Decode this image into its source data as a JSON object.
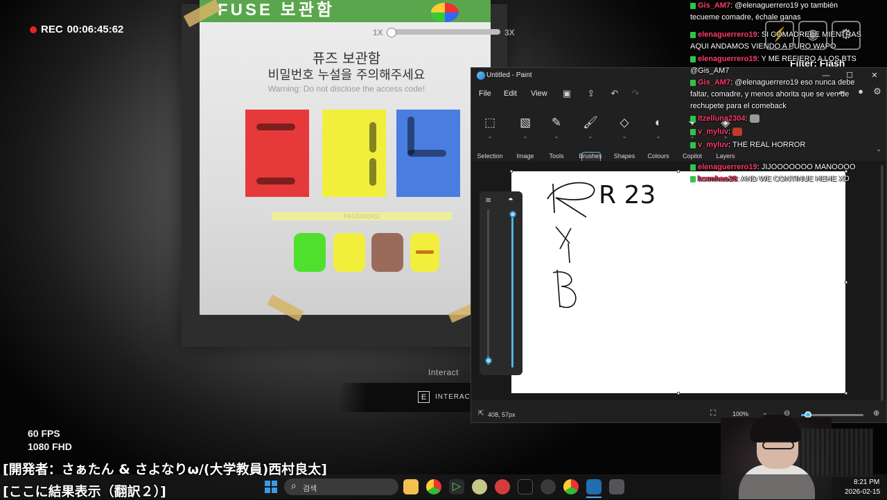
{
  "game": {
    "rec_label": "REC",
    "rec_time": "00:06:45:62",
    "fps_line1": "60 FPS",
    "fps_line2": "1080 FHD",
    "zoom_min": "1X",
    "zoom_max": "3X",
    "banner_text": "FUSE 보관함",
    "notice_title": "퓨즈 보관함",
    "notice_subtitle": "비밀번호 누설을 주의해주세요",
    "notice_warning": "Warning: Do not disclose the access code!",
    "password_label": "PASSWORD",
    "interact_hint": "Interact",
    "interact_key": "E",
    "interact_prompt": "INTERACT"
  },
  "subtitles": {
    "line1": "[開発者：さぁたん & さよなりω/(大学教員)西村良太]",
    "line2": "[ここに結果表示（翻訳２）]"
  },
  "paint": {
    "title": "Untitled - Paint",
    "menus": [
      "File",
      "Edit",
      "View"
    ],
    "ribbon": [
      "Selection",
      "Image",
      "Tools",
      "Brushes",
      "Shapes",
      "Colours",
      "Copilot",
      "Layers"
    ],
    "canvas_text": "R 23",
    "status_coords": "408, 57px",
    "zoom": "100%"
  },
  "overlay": {
    "filter_label": "Filter: Flash"
  },
  "chat": [
    {
      "user": "Gis_AM7",
      "user_color": "#ff3b6b",
      "text": "@elenaguerrero19 yo también tecueme comadre, échale ganas"
    },
    {
      "user": "elenaguerrero19",
      "user_color": "#ff3b6b",
      "text": "SI COMADREEE MIENTRAS AQUI ANDAMOS VIENDO A PURO WAPO"
    },
    {
      "user": "elenaguerrero19",
      "user_color": "#ff3b6b",
      "text": "Y ME REFIERO A LOS BTS @Gis_AM7"
    },
    {
      "user": "Gis_AM7",
      "user_color": "#ff3b6b",
      "text": "@elenaguerrero19 eso nunca debe faltar, comadre, y menos ahorita que se ven de rechupete para el comeback"
    },
    {
      "user": "Itzelluna2304",
      "user_color": "#ff3b6b",
      "text": ""
    },
    {
      "user": "v_myluv",
      "user_color": "#ff3b6b",
      "text": ""
    },
    {
      "user": "v_myluv",
      "user_color": "#ff3b6b",
      "text": "THE REAL HORROR"
    },
    {
      "user": "elenaguerrero19",
      "user_color": "#ff3b6b",
      "text": "JIJOOOOOOO MANOOOO"
    },
    {
      "user": "lxxmhao28",
      "user_color": "#ff3b6b",
      "text": "AND WE CONTINUE HEHE XD"
    }
  ],
  "taskbar": {
    "search_placeholder": "검색",
    "time": "8:21 PM",
    "date": "2026-02-15"
  },
  "colors": {
    "fuse_red": "#e63a3a",
    "fuse_yellow": "#f1ef3c",
    "fuse_blue": "#4a7de0",
    "btn_green": "#4fe02e",
    "btn_yellow": "#f1ef3c",
    "btn_brown": "#9a6b5a",
    "btn_yellow2": "#f1ef3c",
    "accent": "#4fb3e8"
  }
}
